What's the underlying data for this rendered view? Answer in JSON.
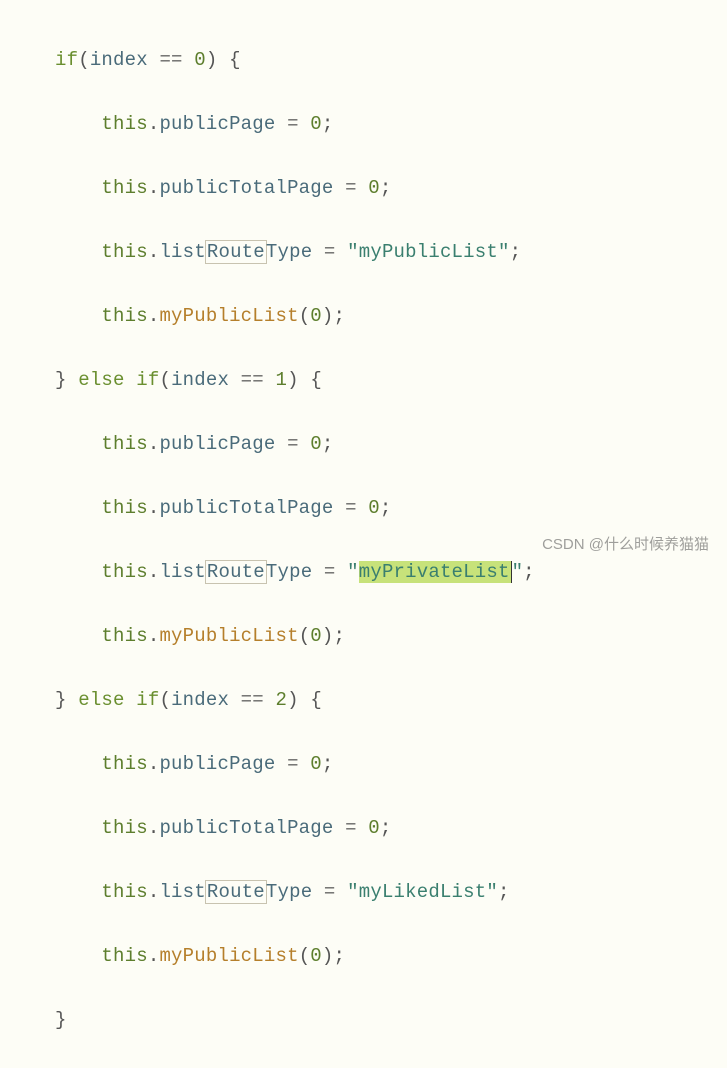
{
  "code": {
    "l1": {
      "kw_if": "if",
      "lp": "(",
      "var": "index",
      "eq": " == ",
      "num": "0",
      "rp": ") {"
    },
    "l2": {
      "this": "this",
      "dot": ".",
      "prop": "publicPage",
      "eq": " = ",
      "num": "0",
      "semi": ";"
    },
    "l3": {
      "this": "this",
      "dot": ".",
      "prop": "publicTotalPage",
      "eq": " = ",
      "num": "0",
      "semi": ";"
    },
    "l4": {
      "this": "this",
      "dot": ".",
      "prop_a": "list",
      "prop_boxed": "Route",
      "prop_b": "Type",
      "eq": " = ",
      "q1": "\"",
      "str": "myPublicList",
      "q2": "\"",
      "semi": ";"
    },
    "l5": {
      "this": "this",
      "dot": ".",
      "method": "myPublicList",
      "lp": "(",
      "num": "0",
      "rp": ")",
      "semi": ";"
    },
    "l6": {
      "rb": "}",
      "kw_else": " else ",
      "kw_if": "if",
      "lp": "(",
      "var": "index",
      "eq": " == ",
      "num": "1",
      "rp": ") {"
    },
    "l7": {
      "this": "this",
      "dot": ".",
      "prop": "publicPage",
      "eq": " = ",
      "num": "0",
      "semi": ";"
    },
    "l8": {
      "this": "this",
      "dot": ".",
      "prop": "publicTotalPage",
      "eq": " = ",
      "num": "0",
      "semi": ";"
    },
    "l9": {
      "this": "this",
      "dot": ".",
      "prop_a": "list",
      "prop_boxed": "Route",
      "prop_b": "Type",
      "eq": " = ",
      "q1": "\"",
      "str": "myPrivateList",
      "q2": "\"",
      "semi": ";"
    },
    "l10": {
      "this": "this",
      "dot": ".",
      "method": "myPublicList",
      "lp": "(",
      "num": "0",
      "rp": ")",
      "semi": ";"
    },
    "l11": {
      "rb": "}",
      "kw_else": " else ",
      "kw_if": "if",
      "lp": "(",
      "var": "index",
      "eq": " == ",
      "num": "2",
      "rp": ") {"
    },
    "l12": {
      "this": "this",
      "dot": ".",
      "prop": "publicPage",
      "eq": " = ",
      "num": "0",
      "semi": ";"
    },
    "l13": {
      "this": "this",
      "dot": ".",
      "prop": "publicTotalPage",
      "eq": " = ",
      "num": "0",
      "semi": ";"
    },
    "l14": {
      "this": "this",
      "dot": ".",
      "prop_a": "list",
      "prop_boxed": "Route",
      "prop_b": "Type",
      "eq": " = ",
      "q1": "\"",
      "str": "myLikedList",
      "q2": "\"",
      "semi": ";"
    },
    "l15": {
      "this": "this",
      "dot": ".",
      "method": "myPublicList",
      "lp": "(",
      "num": "0",
      "rp": ")",
      "semi": ";"
    },
    "l16": {
      "rb": "}"
    }
  },
  "watermark": "CSDN @什么时候养猫猫"
}
